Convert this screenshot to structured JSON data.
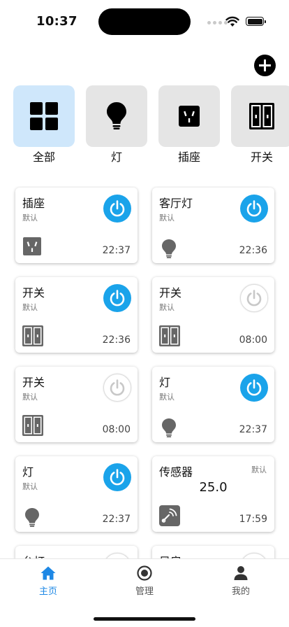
{
  "status_bar": {
    "time": "10:37"
  },
  "header": {
    "add_button_icon": "plus-circle-icon"
  },
  "categories": [
    {
      "label": "全部",
      "icon": "grid-icon",
      "active": true
    },
    {
      "label": "灯",
      "icon": "bulb-icon",
      "active": false
    },
    {
      "label": "插座",
      "icon": "socket-icon",
      "active": false
    },
    {
      "label": "开关",
      "icon": "switch-icon",
      "active": false
    }
  ],
  "devices": [
    {
      "name": "插座",
      "group": "默认",
      "time": "22:37",
      "state": "on",
      "icon": "socket-icon"
    },
    {
      "name": "客厅灯",
      "group": "默认",
      "time": "22:36",
      "state": "on",
      "icon": "bulb-icon"
    },
    {
      "name": "开关",
      "group": "默认",
      "time": "22:36",
      "state": "on",
      "icon": "switch-icon"
    },
    {
      "name": "开关",
      "group": "默认",
      "time": "08:00",
      "state": "off",
      "icon": "switch-icon"
    },
    {
      "name": "开关",
      "group": "默认",
      "time": "08:00",
      "state": "off",
      "icon": "switch-icon"
    },
    {
      "name": "灯",
      "group": "默认",
      "time": "22:37",
      "state": "on",
      "icon": "bulb-icon"
    },
    {
      "name": "灯",
      "group": "默认",
      "time": "22:37",
      "state": "on",
      "icon": "bulb-icon"
    },
    {
      "name": "传感器",
      "group": "默认",
      "value": "25.0",
      "time": "17:59",
      "icon": "sensor-icon"
    },
    {
      "name": "台灯",
      "state": "off"
    },
    {
      "name": "风扇",
      "state": "off"
    }
  ],
  "tabs": [
    {
      "label": "主页",
      "icon": "home-icon",
      "active": true
    },
    {
      "label": "管理",
      "icon": "target-icon",
      "active": false
    },
    {
      "label": "我的",
      "icon": "person-icon",
      "active": false
    }
  ],
  "colors": {
    "accent": "#1aa3ea",
    "tab_active": "#1e88e5",
    "category_active_bg": "#cfe7fb",
    "category_bg": "#e5e5e5"
  }
}
